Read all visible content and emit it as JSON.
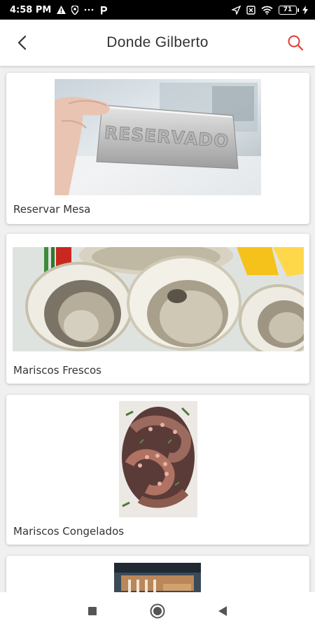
{
  "status": {
    "time": "4:58 PM",
    "battery": "71"
  },
  "header": {
    "title": "Donde Gilberto",
    "back_icon": "back-arrow-icon",
    "search_icon": "search-icon",
    "accent_color": "#e53935"
  },
  "cards": [
    {
      "label": "Reservar Mesa",
      "sign_text": "RESERVADO"
    },
    {
      "label": "Mariscos Frescos"
    },
    {
      "label": "Mariscos Congelados"
    }
  ],
  "navbar": {
    "recents_icon": "square-icon",
    "home_icon": "circle-icon",
    "back_icon": "triangle-back-icon"
  }
}
